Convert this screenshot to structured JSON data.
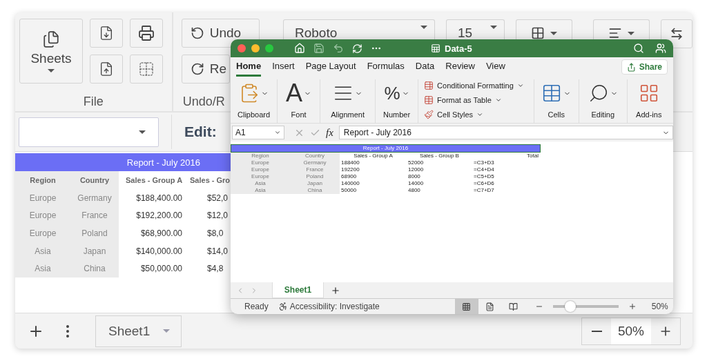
{
  "app": {
    "toolbar": {
      "sheets_button": "Sheets",
      "file_label": "File",
      "undo_button": "Undo",
      "redo_button": "Re",
      "undo_label": "Undo/R",
      "font": "Roboto",
      "font_size": "15"
    },
    "edit_label": "Edit:",
    "sheet": {
      "banner": "Report - July 2016",
      "columns": [
        "Region",
        "Country",
        "Sales - Group A",
        "Sales - Gro"
      ],
      "rows": [
        [
          "Europe",
          "Germany",
          "$188,400.00",
          "$52,0"
        ],
        [
          "Europe",
          "France",
          "$192,200.00",
          "$12,0"
        ],
        [
          "Europe",
          "Poland",
          "$68,900.00",
          "$8,0"
        ],
        [
          "Asia",
          "Japan",
          "$140,000.00",
          "$14,0"
        ],
        [
          "Asia",
          "China",
          "$50,000.00",
          "$4,8"
        ]
      ]
    },
    "bottom_bar": {
      "sheet_tab": "Sheet1",
      "zoom": "50%"
    }
  },
  "excel": {
    "title": "Data-5",
    "tabs": [
      {
        "label": "Home",
        "selected": true
      },
      {
        "label": "Insert",
        "selected": false
      },
      {
        "label": "Page Layout",
        "selected": false
      },
      {
        "label": "Formulas",
        "selected": false
      },
      {
        "label": "Data",
        "selected": false
      },
      {
        "label": "Review",
        "selected": false
      },
      {
        "label": "View",
        "selected": false
      }
    ],
    "share": "Share",
    "ribbon": [
      {
        "kind": "paste",
        "label": "Clipboard"
      },
      {
        "kind": "glyph",
        "glyph": "A",
        "label": "Font"
      },
      {
        "kind": "align",
        "label": "Alignment"
      },
      {
        "kind": "glyph",
        "glyph": "%",
        "label": "Number"
      },
      {
        "kind": "styles",
        "items": [
          "Conditional Formatting",
          "Format as Table",
          "Cell Styles"
        ]
      },
      {
        "kind": "cells",
        "label": "Cells"
      },
      {
        "kind": "find",
        "label": "Editing"
      },
      {
        "kind": "addins",
        "label": "Add-ins"
      }
    ],
    "name_box": "A1",
    "function_label": "fx",
    "formula": "Report - July 2016",
    "grid": {
      "banner": "Report - July 2016",
      "columns": [
        "Region",
        "Country",
        "Sales - Group A",
        "Sales - Group B",
        "Total"
      ],
      "rows": [
        [
          "Europe",
          "Germany",
          "188400",
          "52000",
          "=C3+D3"
        ],
        [
          "Europe",
          "France",
          "192200",
          "12000",
          "=C4+D4"
        ],
        [
          "Europe",
          "Poland",
          "68900",
          "8000",
          "=C5+D5"
        ],
        [
          "Asia",
          "Japan",
          "140000",
          "14000",
          "=C6+D6"
        ],
        [
          "Asia",
          "China",
          "50000",
          "4800",
          "=C7+D7"
        ]
      ]
    },
    "sheet_tabs": [
      {
        "label": "Sheet1",
        "selected": true
      }
    ],
    "status": {
      "ready": "Ready",
      "accessibility": "Accessibility: Investigate",
      "views": [
        {
          "selected": true
        },
        {
          "selected": false
        },
        {
          "selected": false
        }
      ],
      "zoom_slider": {
        "level": 0.27
      },
      "zoom": "50%"
    }
  }
}
